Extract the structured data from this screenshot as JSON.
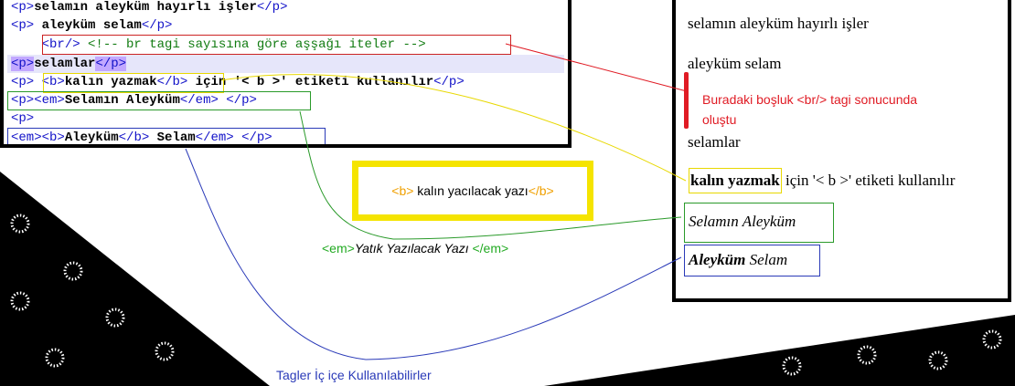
{
  "code": {
    "lines": [
      [
        {
          "t": "<p>",
          "c": "tag"
        },
        {
          "t": "selamın aleyküm hayırlı işler",
          "c": "b"
        },
        {
          "t": "</p>",
          "c": "tag"
        }
      ],
      [
        {
          "t": "<p>",
          "c": "tag"
        },
        {
          "t": " aleyküm selam",
          "c": "b"
        },
        {
          "t": "</p>",
          "c": "tag"
        }
      ],
      [
        {
          "t": "    ",
          "c": ""
        },
        {
          "t": "<br/>",
          "c": "tag"
        },
        {
          "t": " <!-- br tagi sayısına göre aşşağı iteler -->",
          "c": "comment"
        }
      ],
      [
        {
          "t": "<p>",
          "c": "tag tag-hl"
        },
        {
          "t": "selamlar",
          "c": "b"
        },
        {
          "t": "</p>",
          "c": "tag tag-hl"
        }
      ],
      [
        {
          "t": "<p>",
          "c": "tag"
        },
        {
          "t": " ",
          "c": ""
        },
        {
          "t": "<b>",
          "c": "tag"
        },
        {
          "t": "kalın yazmak",
          "c": "b"
        },
        {
          "t": "</b>",
          "c": "tag"
        },
        {
          "t": " için '< b >' etiketi kullanılır",
          "c": "b"
        },
        {
          "t": "</p>",
          "c": "tag"
        }
      ],
      [
        {
          "t": "<p>",
          "c": "tag"
        },
        {
          "t": "<em>",
          "c": "tag"
        },
        {
          "t": "Selamın Aleyküm",
          "c": "b"
        },
        {
          "t": "</em>",
          "c": "tag"
        },
        {
          "t": " ",
          "c": ""
        },
        {
          "t": "</p>",
          "c": "tag"
        }
      ],
      [
        {
          "t": "<p>",
          "c": "tag"
        }
      ],
      [
        {
          "t": "<em>",
          "c": "tag"
        },
        {
          "t": "<b>",
          "c": "tag"
        },
        {
          "t": "Aleyküm",
          "c": "b"
        },
        {
          "t": "</b>",
          "c": "tag"
        },
        {
          "t": " Selam",
          "c": "b"
        },
        {
          "t": "</em>",
          "c": "tag"
        },
        {
          "t": " ",
          "c": ""
        },
        {
          "t": "</p>",
          "c": "tag"
        }
      ]
    ]
  },
  "bold_note": {
    "open": "<b>",
    "text": " kalın yacılacak yazı",
    "close": "</b>"
  },
  "em_note": {
    "open": "<em>",
    "text": "Yatık Yazılacak Yazı",
    "close": "</em>"
  },
  "nest_note": "Tagler İç içe Kullanılabilirler",
  "render": {
    "line1": "selamın aleyküm hayırlı işler",
    "line2": "aleyküm selam",
    "br_note": "Buradaki boşluk <br/> tagi sonucunda oluştu",
    "line3": "selamlar",
    "bold_word": "kalın yazmak",
    "bold_rest": " için '< b >' etiketi kullanılır",
    "italic_line": "Selamın Aleyküm",
    "nested_bold": "Aleyküm",
    "nested_rest": " Selam"
  },
  "colors": {
    "red": "#e01b24",
    "yellow": "#f5e400",
    "green": "#2a9a2a",
    "blue": "#2a3ab8",
    "tag_blue": "#1010c8"
  }
}
